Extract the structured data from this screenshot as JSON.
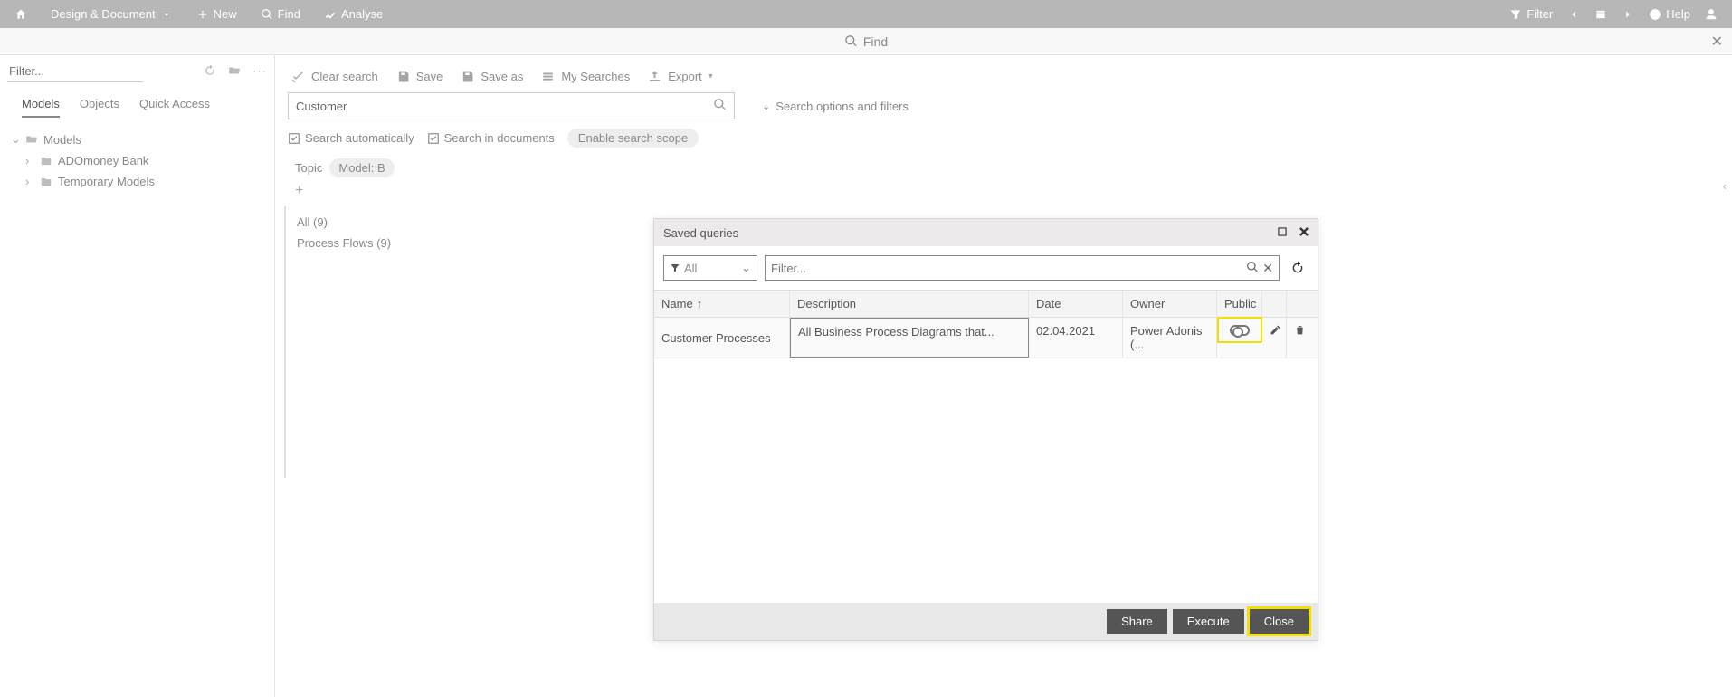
{
  "topbar": {
    "design_label": "Design & Document",
    "new_label": "New",
    "find_label": "Find",
    "analyse_label": "Analyse",
    "filter_label": "Filter",
    "help_label": "Help"
  },
  "findbar": {
    "title": "Find"
  },
  "left": {
    "filter_placeholder": "Filter...",
    "tabs": {
      "models": "Models",
      "objects": "Objects",
      "quick": "Quick Access"
    },
    "tree": {
      "root": "Models",
      "items": [
        "ADOmoney Bank",
        "Temporary Models"
      ]
    }
  },
  "main": {
    "toolbar": {
      "clear": "Clear search",
      "save": "Save",
      "saveas": "Save as",
      "mysearches": "My Searches",
      "export": "Export"
    },
    "search_value": "Customer",
    "opts_link": "Search options and filters",
    "chk_auto": "Search automatically",
    "chk_docs": "Search in documents",
    "scope_pill": "Enable search scope",
    "chip_topic": "Topic",
    "chip_model": "Model: B",
    "counts": {
      "all": "All (9)",
      "pf": "Process Flows (9)"
    }
  },
  "modal": {
    "title": "Saved queries",
    "select_all": "All",
    "filter_placeholder": "Filter...",
    "headers": {
      "name": "Name",
      "desc": "Description",
      "date": "Date",
      "owner": "Owner",
      "public": "Public"
    },
    "rows": [
      {
        "name": "Customer Processes",
        "desc": "All Business Process Diagrams that...",
        "date": "02.04.2021",
        "owner": "Power Adonis (...",
        "public": false
      }
    ],
    "buttons": {
      "share": "Share",
      "execute": "Execute",
      "close": "Close"
    }
  }
}
